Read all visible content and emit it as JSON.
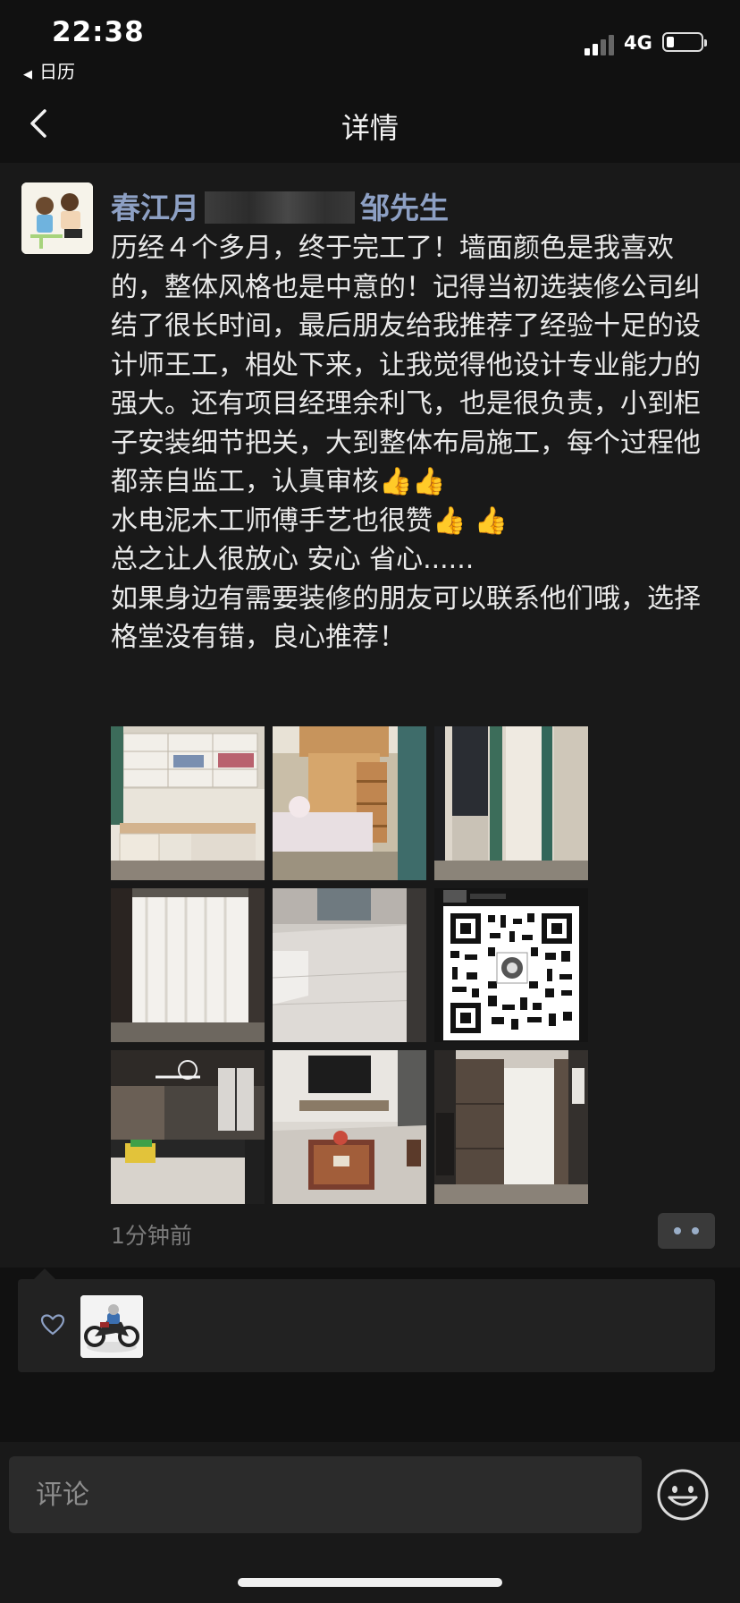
{
  "status_bar": {
    "time": "22:38",
    "back_app": "日历",
    "network": "4G",
    "signal_bars_filled": 2,
    "battery_level": 0.15
  },
  "nav": {
    "title": "详情",
    "back_icon": "chevron-left-icon"
  },
  "post": {
    "author_prefix": "春江月",
    "author_suffix": "邹先生",
    "text": "历经４个多月，终于完工了！墙面颜色是我喜欢的，整体风格也是中意的！记得当初选装修公司纠结了很长时间，最后朋友给我推荐了经验十足的设计师王工，相处下来，让我觉得他设计专业能力的强大。还有项目经理余利飞，也是很负责，小到柜子安装细节把关，大到整体布局施工，每个过程他都亲自监工，认真审核👍👍\n水电泥木工师傅手艺也很赞👍 👍\n总之让人很放心 安心 省心......\n如果身边有需要装修的朋友可以联系他们哦，选择格堂没有错，良心推荐！",
    "timestamp": "1分钟前",
    "photos": [
      {
        "name": "photo-study-desk"
      },
      {
        "name": "photo-bunk-bed"
      },
      {
        "name": "photo-curtain-window"
      },
      {
        "name": "photo-white-curtains"
      },
      {
        "name": "photo-empty-room"
      },
      {
        "name": "photo-qr-code"
      },
      {
        "name": "photo-kitchen"
      },
      {
        "name": "photo-living-room"
      },
      {
        "name": "photo-hallway-cabinet"
      }
    ]
  },
  "likes": {
    "icon": "heart-outline-icon",
    "count": 1
  },
  "comment": {
    "placeholder": "评论",
    "emoji_icon": "emoji-smile-icon"
  },
  "colors": {
    "background": "#111111",
    "panel": "#191919",
    "author_link": "#8da0c4",
    "timestamp": "#7a7a7a",
    "likes_panel": "#222222"
  }
}
